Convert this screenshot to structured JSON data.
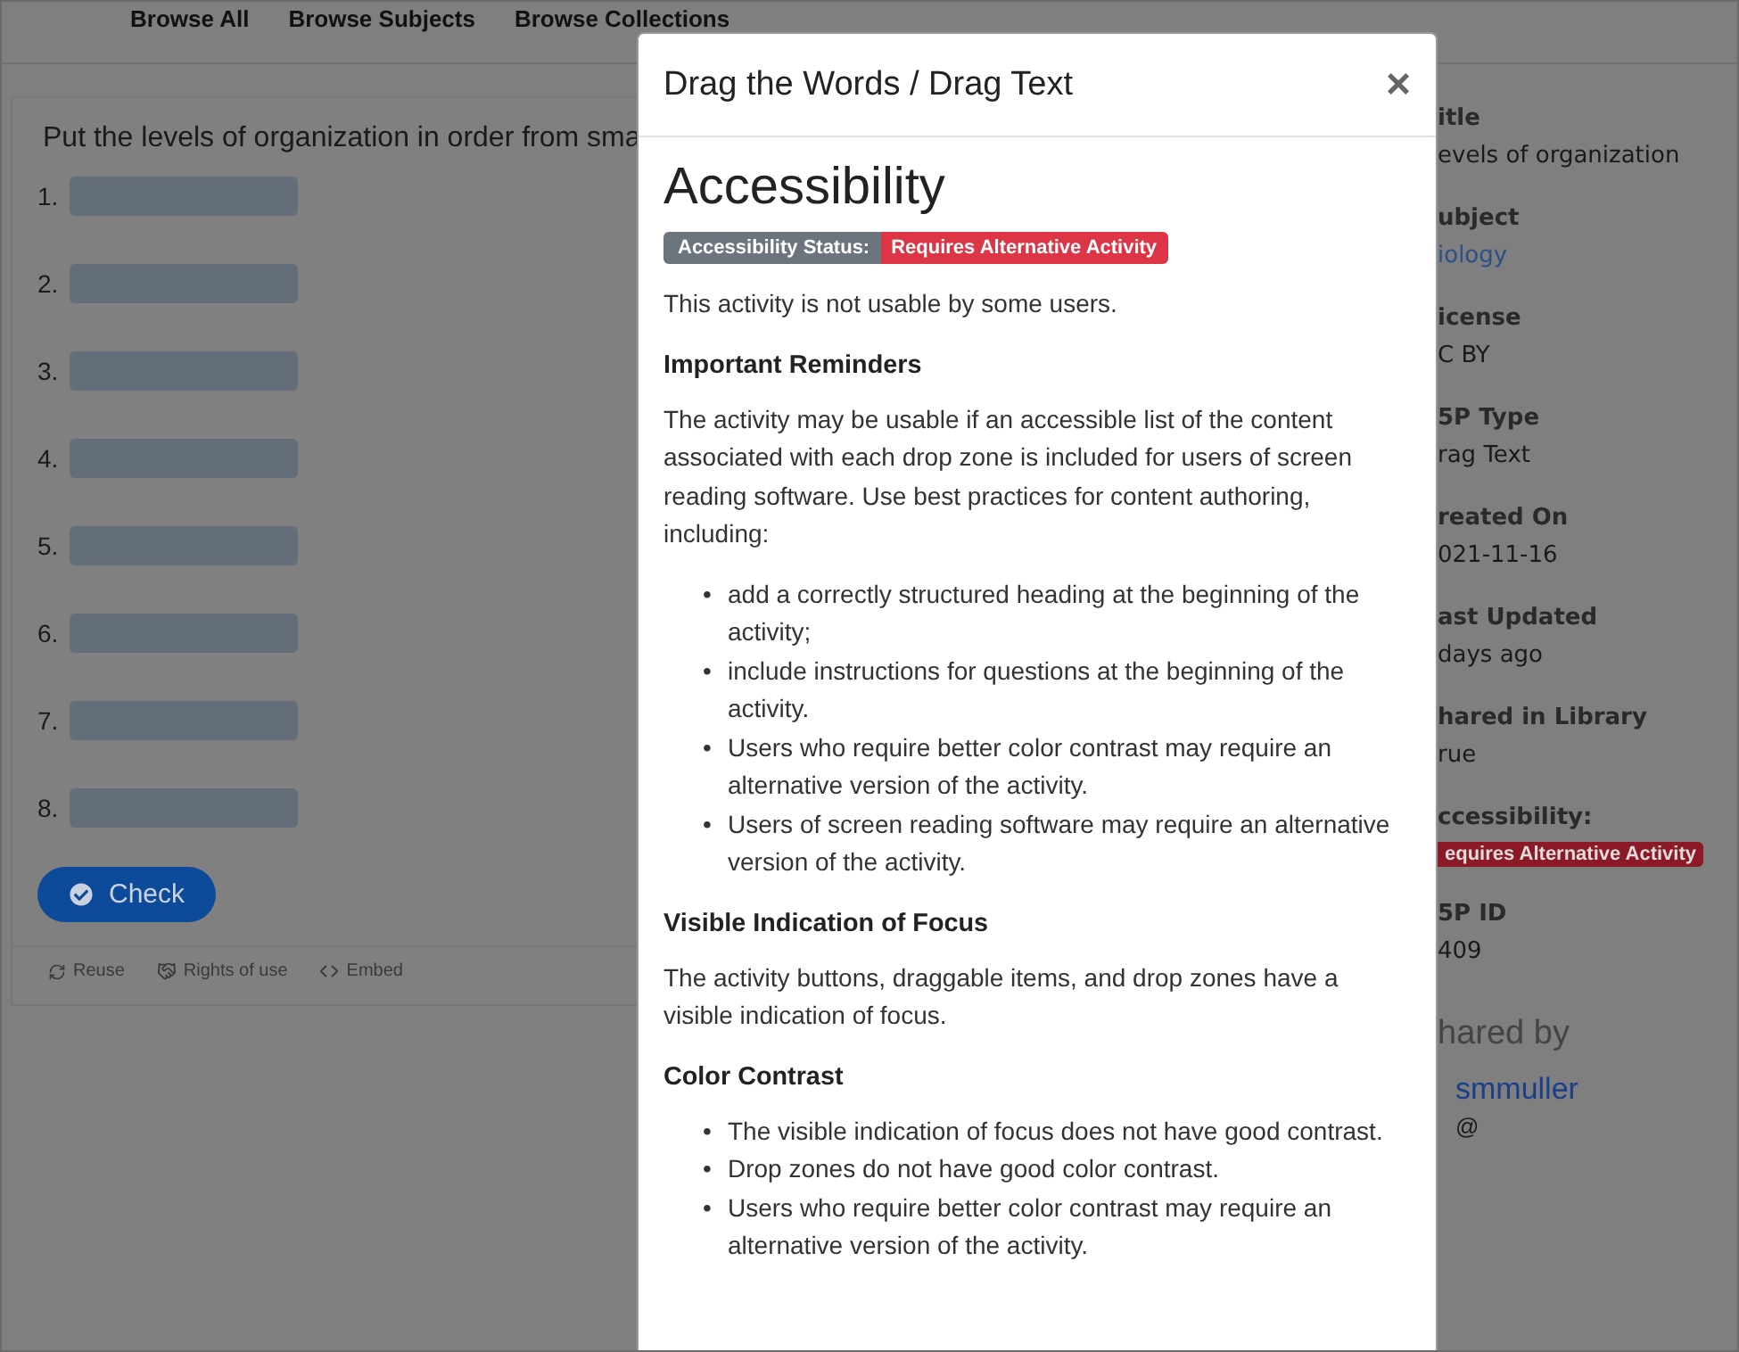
{
  "nav": [
    "Browse All",
    "Browse Subjects",
    "Browse Collections"
  ],
  "activity": {
    "question": "Put the levels of organization in order from sma",
    "drop_zones": [
      {
        "number": "1."
      },
      {
        "number": "2."
      },
      {
        "number": "3."
      },
      {
        "number": "4."
      },
      {
        "number": "5."
      },
      {
        "number": "6."
      },
      {
        "number": "7."
      },
      {
        "number": "8."
      }
    ],
    "check_button": "Check",
    "footer": [
      {
        "kind": "reuse",
        "label": "Reuse"
      },
      {
        "kind": "rights",
        "label": "Rights of use"
      },
      {
        "kind": "embed",
        "label": "Embed"
      }
    ]
  },
  "sidebar": {
    "fields": [
      {
        "label": "itle",
        "value": "evels of organization",
        "kind": "text"
      },
      {
        "label": "ubject",
        "value": "iology",
        "kind": "link"
      },
      {
        "label": "icense",
        "value": "C BY",
        "kind": "text"
      },
      {
        "label": "5P Type",
        "value": "rag Text",
        "kind": "text"
      },
      {
        "label": "reated On",
        "value": "021-11-16",
        "kind": "text"
      },
      {
        "label": "ast Updated",
        "value": "days ago",
        "kind": "text"
      },
      {
        "label": "hared in Library",
        "value": "rue",
        "kind": "text"
      },
      {
        "label": "ccessibility:",
        "value": "equires Alternative Activity",
        "kind": "badge"
      },
      {
        "label": "5P ID",
        "value": "409",
        "kind": "text"
      }
    ],
    "shared_by": {
      "heading": "hared by",
      "user": "smmuller",
      "handle": "@"
    }
  },
  "modal": {
    "title": "Drag the Words / Drag Text",
    "close": "×",
    "heading": "Accessibility",
    "status": {
      "label": "Accessibility Status:",
      "value": "Requires Alternative Activity"
    },
    "intro": "This activity is not usable by some users.",
    "sections": [
      {
        "heading": "Important Reminders",
        "blocks": [
          {
            "kind": "paragraph",
            "text": "The activity may be usable if an accessible list of the content associated with each drop zone is included for users of screen reading software. Use best practices for content authoring, including:"
          },
          {
            "kind": "list",
            "marker": "•",
            "items": [
              "add a correctly structured heading at the beginning of the activity;",
              "include instructions for questions at the beginning of the activity.",
              "Users who require better color contrast may require an alternative version of the activity.",
              "Users of screen reading software may require an alternative version of the activity."
            ]
          }
        ]
      },
      {
        "heading": "Visible Indication of Focus",
        "blocks": [
          {
            "kind": "paragraph",
            "text": "The activity buttons, draggable items, and drop zones have a visible indication of focus."
          }
        ]
      },
      {
        "heading": "Color Contrast",
        "blocks": [
          {
            "kind": "list",
            "marker": "•",
            "items": [
              "The visible indication of focus does not have good contrast.",
              "Drop zones do not have good color contrast.",
              "Users who require better color contrast may require an alternative version of the activity."
            ]
          }
        ]
      }
    ]
  }
}
